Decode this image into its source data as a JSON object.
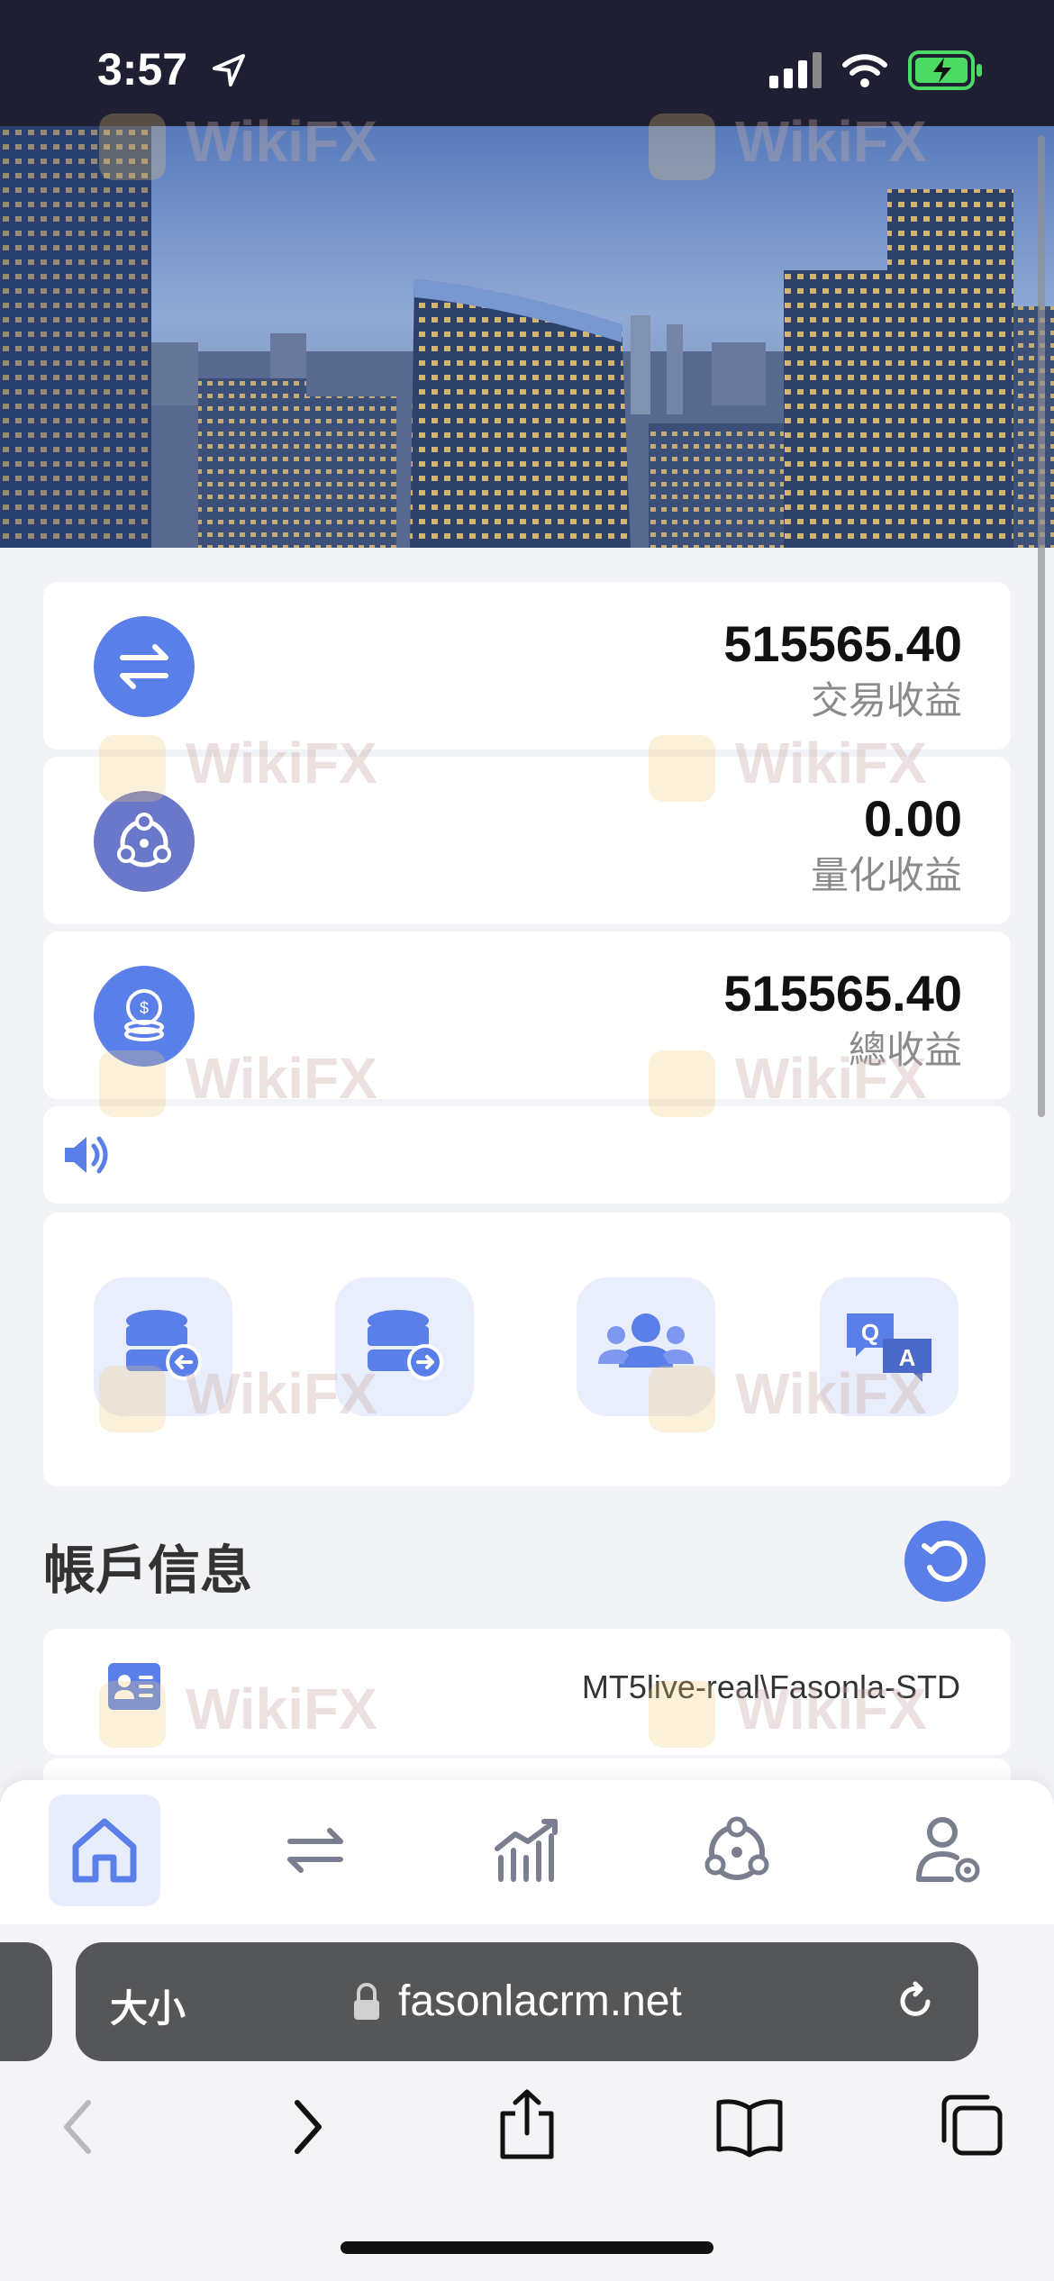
{
  "status_bar": {
    "time": "3:57"
  },
  "stats": [
    {
      "value": "515565.40",
      "label": "交易收益",
      "icon": "swap-arrows-icon"
    },
    {
      "value": "0.00",
      "label": "量化收益",
      "icon": "quant-nodes-icon"
    },
    {
      "value": "515565.40",
      "label": "總收益",
      "icon": "coins-icon"
    }
  ],
  "notice_icon": "speaker-icon",
  "quick_actions": [
    {
      "icon": "deposit-database-icon"
    },
    {
      "icon": "withdraw-database-icon"
    },
    {
      "icon": "team-users-icon"
    },
    {
      "icon": "qa-chat-icon"
    }
  ],
  "account_section": {
    "title": "帳戶信息",
    "refresh_icon": "refresh-icon",
    "server": "MT5live-real\\Fasonla-STD"
  },
  "tab_bar": [
    {
      "icon": "home-icon",
      "active": true
    },
    {
      "icon": "swap-icon",
      "active": false
    },
    {
      "icon": "chart-icon",
      "active": false
    },
    {
      "icon": "quant-icon",
      "active": false
    },
    {
      "icon": "user-settings-icon",
      "active": false
    }
  ],
  "browser": {
    "text_size_label": "大小",
    "url": "fasonlacrm.net"
  },
  "watermark": "WikiFX",
  "colors": {
    "accent": "#5b7fe8",
    "accent_secondary": "#6b78c9",
    "status_bar_bg": "#1e1f33",
    "battery": "#4cd964"
  }
}
